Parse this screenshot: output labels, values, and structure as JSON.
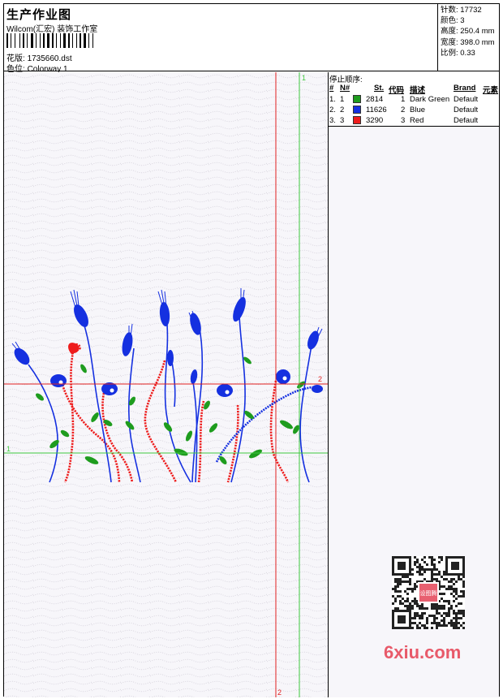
{
  "header": {
    "title": "生产作业图",
    "company": "Wilcom(汇宏) 装饰工作室",
    "design_label": "花版:",
    "design_file": "1735660.dst",
    "colorway_label": "色位:",
    "colorway": "Colorway 1"
  },
  "info": {
    "stitches": "针数: 17732",
    "colors": "颜色: 3",
    "height": "高度: 250.4 mm",
    "width": "宽度: 398.0 mm",
    "scale": "比例: 0.33"
  },
  "stop_sequence": {
    "title": "停止顺序:",
    "headers": [
      "#",
      "N#",
      "St.",
      "代码",
      "描述",
      "Brand",
      "元素"
    ],
    "rows": [
      {
        "num": "1.",
        "n": "1",
        "stitches": "2814",
        "code": "1",
        "description": "Dark Green",
        "brand": "Default",
        "color": "#1e9c1e"
      },
      {
        "num": "2.",
        "n": "2",
        "stitches": "11626",
        "code": "2",
        "description": "Blue",
        "brand": "Default",
        "color": "#1530e0"
      },
      {
        "num": "3.",
        "n": "3",
        "stitches": "3290",
        "code": "3",
        "description": "Red",
        "brand": "Default",
        "color": "#ee1c1c"
      }
    ]
  },
  "guides": {
    "green_vertical_label": "1",
    "red_horizontal_label": "2",
    "green_horizontal_label": "1",
    "red_vertical_label": "2"
  },
  "watermark": {
    "text": "6xiu.com",
    "qr_center": "设图腾"
  },
  "colors": {
    "green": "#1e9c1e",
    "blue": "#1530e0",
    "red": "#ee1c1c",
    "guide_green": "#3ec83e",
    "guide_red": "#e02020"
  }
}
